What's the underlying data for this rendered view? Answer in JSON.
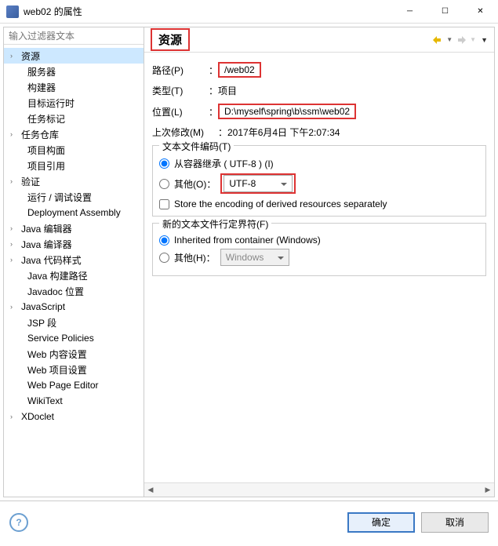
{
  "window": {
    "title": "web02 的属性"
  },
  "filter": {
    "placeholder": "输入过滤器文本"
  },
  "tree": [
    {
      "label": "资源",
      "expandable": true,
      "selected": true
    },
    {
      "label": "服务器",
      "child": true
    },
    {
      "label": "构建器",
      "child": true
    },
    {
      "label": "目标运行时",
      "child": true
    },
    {
      "label": "任务标记",
      "child": true
    },
    {
      "label": "任务仓库",
      "expandable": true
    },
    {
      "label": "项目构面",
      "child": true
    },
    {
      "label": "项目引用",
      "child": true
    },
    {
      "label": "验证",
      "expandable": true
    },
    {
      "label": "运行 / 调试设置",
      "child": true
    },
    {
      "label": "Deployment Assembly",
      "child": true
    },
    {
      "label": "Java 编辑器",
      "expandable": true
    },
    {
      "label": "Java 编译器",
      "expandable": true
    },
    {
      "label": "Java 代码样式",
      "expandable": true
    },
    {
      "label": "Java 构建路径",
      "child": true
    },
    {
      "label": "Javadoc 位置",
      "child": true
    },
    {
      "label": "JavaScript",
      "expandable": true
    },
    {
      "label": "JSP 段",
      "child": true
    },
    {
      "label": "Service Policies",
      "child": true
    },
    {
      "label": "Web 内容设置",
      "child": true
    },
    {
      "label": "Web 项目设置",
      "child": true
    },
    {
      "label": "Web Page Editor",
      "child": true
    },
    {
      "label": "WikiText",
      "child": true
    },
    {
      "label": "XDoclet",
      "expandable": true
    }
  ],
  "heading": "资源",
  "props": {
    "path_label": "路径(P)",
    "path_value": "/web02",
    "type_label": "类型(T)",
    "type_value": "项目",
    "location_label": "位置(L)",
    "location_value": "D:\\myself\\spring\\b\\ssm\\web02",
    "modified_label": "上次修改(M)",
    "modified_value": "2017年6月4日 下午2:07:34"
  },
  "encoding": {
    "group_title": "文本文件编码(T)",
    "inherit_label": "从容器继承 ( UTF-8 ) (I)",
    "other_label": "其他(O)",
    "other_value": "UTF-8",
    "store_label": "Store the encoding of derived resources separately"
  },
  "delimiter": {
    "group_title": "新的文本文件行定界符(F)",
    "inherit_label": "Inherited from container (Windows)",
    "other_label": "其他(H)",
    "other_value": "Windows"
  },
  "buttons": {
    "ok": "确定",
    "cancel": "取消"
  },
  "colon": "："
}
